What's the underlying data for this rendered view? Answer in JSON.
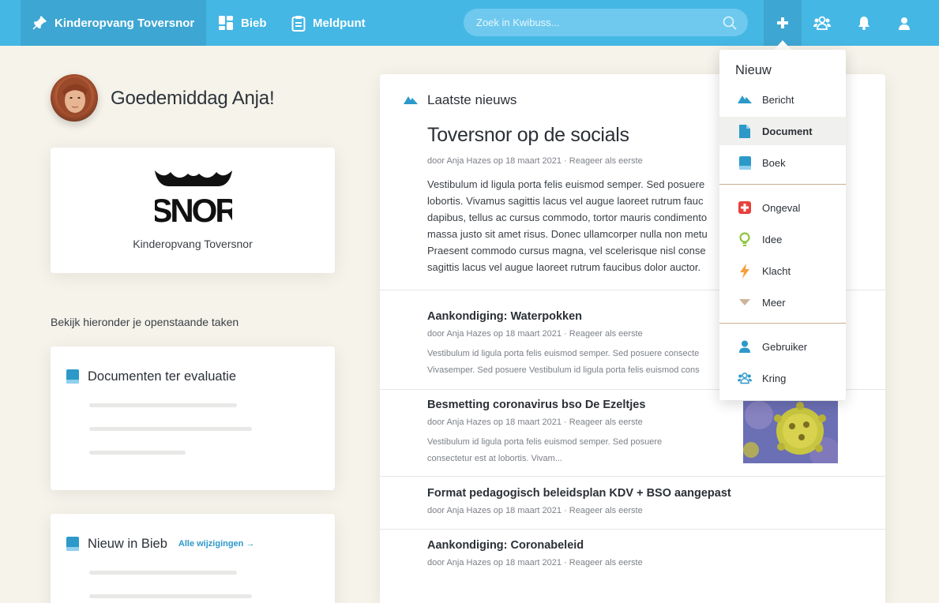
{
  "topbar": {
    "home_label": "Kinderopvang Toversnor",
    "nav": [
      {
        "label": "Bieb",
        "icon": "grid-icon"
      },
      {
        "label": "Meldpunt",
        "icon": "clipboard-icon"
      }
    ],
    "search_placeholder": "Zoek in Kwibuss...",
    "icons": [
      "plus-icon",
      "group-icon",
      "bell-icon",
      "user-icon"
    ]
  },
  "greeting": "Goedemiddag Anja!",
  "organization": {
    "name": "Kinderopvang Toversnor",
    "logo_text": "SNOR"
  },
  "tasks_intro": "Bekijk hieronder je openstaande taken",
  "task_cards": [
    {
      "title": "Documenten ter evaluatie",
      "link": ""
    },
    {
      "title": "Nieuw in Bieb",
      "link": "Alle wijzigingen →"
    }
  ],
  "news": {
    "heading": "Laatste nieuws",
    "featured": {
      "title": "Toversnor op de socials",
      "meta": "door Anja Hazes op 18 maart 2021 · Reageer als eerste",
      "body": [
        "Vestibulum id ligula porta felis euismod semper. Sed posuere",
        "lobortis. Vivamus sagittis lacus vel augue laoreet rutrum fauc",
        "dapibus, tellus ac cursus commodo, tortor mauris condimento",
        "massa justo sit amet risus. Donec ullamcorper nulla non metu",
        "Praesent commodo cursus magna, vel scelerisque nisl conse",
        "sagittis lacus vel augue laoreet rutrum faucibus dolor auctor."
      ]
    },
    "items": [
      {
        "title": "Aankondiging: Waterpokken",
        "meta": "door Anja Hazes op 18 maart 2021 · Reageer als eerste",
        "excerpt": [
          "Vestibulum id ligula porta felis euismod semper. Sed posuere consecte",
          "Vivasemper. Sed posuere Vestibulum id ligula porta felis euismod cons"
        ]
      },
      {
        "title": "Besmetting coronavirus bso De Ezeltjes",
        "meta": "door Anja Hazes op 18 maart 2021 · Reageer als eerste",
        "excerpt": [
          "Vestibulum id ligula porta felis euismod semper. Sed posuere",
          "consectetur est at lobortis. Vivam..."
        ]
      },
      {
        "title": "Format pedagogisch beleidsplan KDV + BSO aangepast",
        "meta": "door Anja Hazes op 18 maart 2021 · Reageer als eerste",
        "excerpt": []
      },
      {
        "title": "Aankondiging: Coronabeleid",
        "meta": "door Anja Hazes op 18 maart 2021 · Reageer als eerste",
        "excerpt": []
      }
    ]
  },
  "dropdown": {
    "title": "Nieuw",
    "groups": [
      [
        {
          "label": "Bericht",
          "icon": "megaphone-icon",
          "color": "#2c99c9"
        },
        {
          "label": "Document",
          "icon": "document-icon",
          "color": "#2c99c9",
          "active": true
        },
        {
          "label": "Boek",
          "icon": "book-icon",
          "color": "#2c99c9"
        }
      ],
      [
        {
          "label": "Ongeval",
          "icon": "first-aid-icon",
          "color": "#e8413c"
        },
        {
          "label": "Idee",
          "icon": "lightbulb-icon",
          "color": "#8cc63f"
        },
        {
          "label": "Klacht",
          "icon": "lightning-icon",
          "color": "#f5a03a"
        },
        {
          "label": "Meer",
          "icon": "triangle-down-icon",
          "color": "#cdb59a"
        }
      ],
      [
        {
          "label": "Gebruiker",
          "icon": "user-icon",
          "color": "#2c99c9"
        },
        {
          "label": "Kring",
          "icon": "group-icon",
          "color": "#2c99c9"
        }
      ]
    ]
  },
  "colors": {
    "topbar": "#45b7e4",
    "topbar_active": "#3ea6d2",
    "accent": "#2c99c9",
    "background": "#f5f3ea"
  }
}
